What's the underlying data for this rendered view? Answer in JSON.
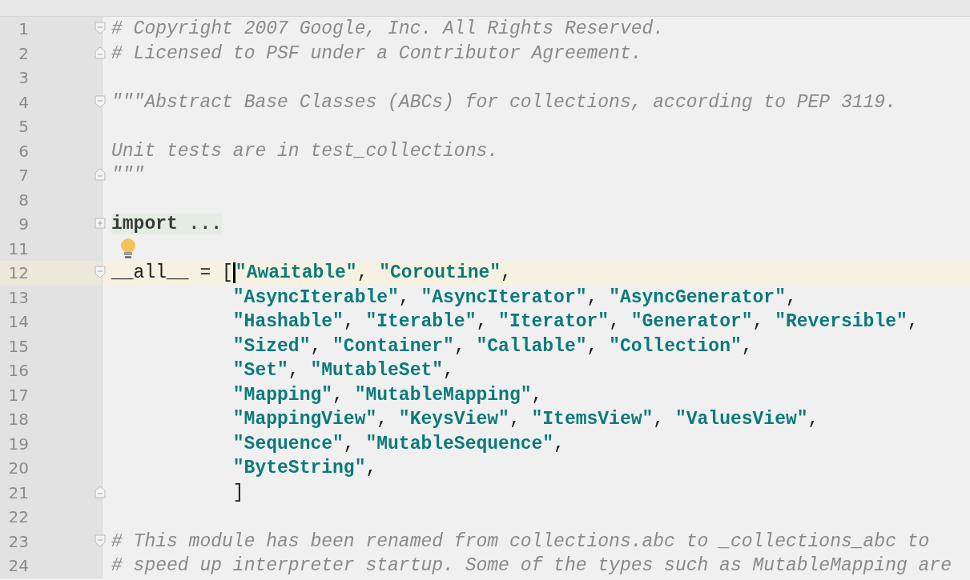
{
  "editor": {
    "lines": [
      {
        "number": "1",
        "kind": "code",
        "fold": {
          "kind": "start"
        },
        "tokens": [
          {
            "kind": "comment",
            "text": "# Copyright 2007 Google, Inc. All Rights Reserved."
          }
        ]
      },
      {
        "number": "2",
        "kind": "code",
        "fold": {
          "kind": "end"
        },
        "tokens": [
          {
            "kind": "comment",
            "text": "# Licensed to PSF under a Contributor Agreement."
          }
        ]
      },
      {
        "number": "3",
        "kind": "code"
      },
      {
        "number": "4",
        "kind": "code",
        "fold": {
          "kind": "start"
        },
        "tokens": [
          {
            "kind": "docstring",
            "text": "\"\"\"Abstract Base Classes (ABCs) for collections, according to PEP 3119."
          }
        ]
      },
      {
        "number": "5",
        "kind": "code"
      },
      {
        "number": "6",
        "kind": "code",
        "tokens": [
          {
            "kind": "docstring",
            "text": "Unit tests are in test_collections."
          }
        ]
      },
      {
        "number": "7",
        "kind": "code",
        "fold": {
          "kind": "end"
        },
        "tokens": [
          {
            "kind": "docstring",
            "text": "\"\"\""
          }
        ]
      },
      {
        "number": "8",
        "kind": "code"
      },
      {
        "number": "9",
        "kind": "code",
        "fold": {
          "kind": "collapsed"
        },
        "tokens": [
          {
            "kind": "folded",
            "text": "import ..."
          }
        ]
      },
      {
        "number": "11",
        "kind": "code",
        "bulb": true
      },
      {
        "number": "12",
        "kind": "code",
        "fold": {
          "kind": "start"
        },
        "current": true,
        "tokens": [
          {
            "kind": "plain",
            "text": "__all__ = ["
          },
          {
            "kind": "caret"
          },
          {
            "kind": "string",
            "text": "\"Awaitable\""
          },
          {
            "kind": "plain",
            "text": ", "
          },
          {
            "kind": "string",
            "text": "\"Coroutine\""
          },
          {
            "kind": "plain",
            "text": ","
          }
        ]
      },
      {
        "number": "13",
        "kind": "continuation",
        "tokens": [
          {
            "kind": "string",
            "text": "\"AsyncIterable\""
          },
          {
            "kind": "plain",
            "text": ", "
          },
          {
            "kind": "string",
            "text": "\"AsyncIterator\""
          },
          {
            "kind": "plain",
            "text": ", "
          },
          {
            "kind": "string",
            "text": "\"AsyncGenerator\""
          },
          {
            "kind": "plain",
            "text": ","
          }
        ]
      },
      {
        "number": "14",
        "kind": "continuation",
        "tokens": [
          {
            "kind": "string",
            "text": "\"Hashable\""
          },
          {
            "kind": "plain",
            "text": ", "
          },
          {
            "kind": "string",
            "text": "\"Iterable\""
          },
          {
            "kind": "plain",
            "text": ", "
          },
          {
            "kind": "string",
            "text": "\"Iterator\""
          },
          {
            "kind": "plain",
            "text": ", "
          },
          {
            "kind": "string",
            "text": "\"Generator\""
          },
          {
            "kind": "plain",
            "text": ", "
          },
          {
            "kind": "string",
            "text": "\"Reversible\""
          },
          {
            "kind": "plain",
            "text": ","
          }
        ]
      },
      {
        "number": "15",
        "kind": "continuation",
        "tokens": [
          {
            "kind": "string",
            "text": "\"Sized\""
          },
          {
            "kind": "plain",
            "text": ", "
          },
          {
            "kind": "string",
            "text": "\"Container\""
          },
          {
            "kind": "plain",
            "text": ", "
          },
          {
            "kind": "string",
            "text": "\"Callable\""
          },
          {
            "kind": "plain",
            "text": ", "
          },
          {
            "kind": "string",
            "text": "\"Collection\""
          },
          {
            "kind": "plain",
            "text": ","
          }
        ]
      },
      {
        "number": "16",
        "kind": "continuation",
        "tokens": [
          {
            "kind": "string",
            "text": "\"Set\""
          },
          {
            "kind": "plain",
            "text": ", "
          },
          {
            "kind": "string",
            "text": "\"MutableSet\""
          },
          {
            "kind": "plain",
            "text": ","
          }
        ]
      },
      {
        "number": "17",
        "kind": "continuation",
        "tokens": [
          {
            "kind": "string",
            "text": "\"Mapping\""
          },
          {
            "kind": "plain",
            "text": ", "
          },
          {
            "kind": "string",
            "text": "\"MutableMapping\""
          },
          {
            "kind": "plain",
            "text": ","
          }
        ]
      },
      {
        "number": "18",
        "kind": "continuation",
        "tokens": [
          {
            "kind": "string",
            "text": "\"MappingView\""
          },
          {
            "kind": "plain",
            "text": ", "
          },
          {
            "kind": "string",
            "text": "\"KeysView\""
          },
          {
            "kind": "plain",
            "text": ", "
          },
          {
            "kind": "string",
            "text": "\"ItemsView\""
          },
          {
            "kind": "plain",
            "text": ", "
          },
          {
            "kind": "string",
            "text": "\"ValuesView\""
          },
          {
            "kind": "plain",
            "text": ","
          }
        ]
      },
      {
        "number": "19",
        "kind": "continuation",
        "tokens": [
          {
            "kind": "string",
            "text": "\"Sequence\""
          },
          {
            "kind": "plain",
            "text": ", "
          },
          {
            "kind": "string",
            "text": "\"MutableSequence\""
          },
          {
            "kind": "plain",
            "text": ","
          }
        ]
      },
      {
        "number": "20",
        "kind": "continuation",
        "tokens": [
          {
            "kind": "string",
            "text": "\"ByteString\""
          },
          {
            "kind": "plain",
            "text": ","
          }
        ]
      },
      {
        "number": "21",
        "kind": "continuation",
        "fold": {
          "kind": "end"
        },
        "tokens": [
          {
            "kind": "plain",
            "text": "]"
          }
        ]
      },
      {
        "number": "22",
        "kind": "code"
      },
      {
        "number": "23",
        "kind": "code",
        "fold": {
          "kind": "start"
        },
        "tokens": [
          {
            "kind": "comment",
            "text": "# This module has been renamed from collections.abc to _collections_abc to"
          }
        ]
      },
      {
        "number": "24",
        "kind": "code",
        "tokens": [
          {
            "kind": "comment",
            "text": "# speed up interpreter startup. Some of the types such as MutableMapping are"
          }
        ]
      }
    ]
  }
}
